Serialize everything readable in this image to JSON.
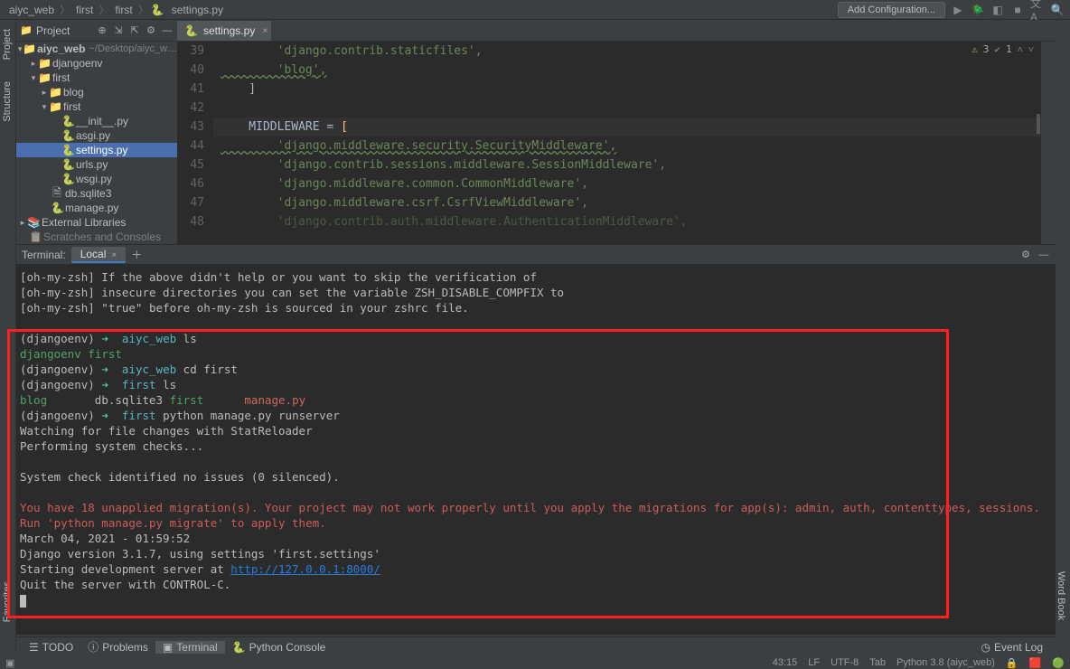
{
  "breadcrumbs": {
    "c1": "aiyc_web",
    "c2": "first",
    "c3": "first",
    "c4": "settings.py"
  },
  "topbar": {
    "config": "Add Configuration..."
  },
  "proj": {
    "title": "Project"
  },
  "tree": {
    "root": "aiyc_web",
    "root_path": "~/Desktop/aiyc_w…",
    "djangoenv": "djangoenv",
    "first1": "first",
    "blog": "blog",
    "first2": "first",
    "init": "__init__.py",
    "asgi": "asgi.py",
    "settings": "settings.py",
    "urls": "urls.py",
    "wsgi": "wsgi.py",
    "db": "db.sqlite3",
    "manage": "manage.py",
    "extlib": "External Libraries",
    "scratch": "Scratches and Consoles"
  },
  "tab": {
    "file": "settings.py"
  },
  "editor_status": {
    "warn": "3",
    "ok": "1"
  },
  "code": {
    "l39n": "39",
    "l39": "        'django.contrib.staticfiles',",
    "l40n": "40",
    "l40": "        'blog',",
    "l41n": "41",
    "l41": "    ]",
    "l42n": "42",
    "l42": "",
    "l43n": "43",
    "l43a": "    MIDDLEWARE = ",
    "l43b": "[",
    "l44n": "44",
    "l44": "        'django.middleware.security.SecurityMiddleware',",
    "l45n": "45",
    "l45": "        'django.contrib.sessions.middleware.SessionMiddleware',",
    "l46n": "46",
    "l46": "        'django.middleware.common.CommonMiddleware',",
    "l47n": "47",
    "l47": "        'django.middleware.csrf.CsrfViewMiddleware',",
    "l48n": "48",
    "l48": "        'django.contrib.auth.middleware.AuthenticationMiddleware',"
  },
  "terminal": {
    "header": "Terminal:",
    "tab": "Local",
    "h1": "[oh-my-zsh] If the above didn't help or you want to skip the verification of",
    "h2": "[oh-my-zsh] insecure directories you can set the variable ZSH_DISABLE_COMPFIX to",
    "h3": "[oh-my-zsh] \"true\" before oh-my-zsh is sourced in your zshrc file.",
    "env": "(djangoenv)",
    "arr": "➜",
    "p1": "aiyc_web",
    "c1": "ls",
    "ls1a": "djangoenv",
    "ls1b": "first",
    "c2": "cd first",
    "p2": "first",
    "c3": "ls",
    "ls2a": "blog",
    "ls2b": "db.sqlite3",
    "ls2c": "first",
    "ls2d": "manage.py",
    "c4": "python manage.py runserver",
    "o1": "Watching for file changes with StatReloader",
    "o2": "Performing system checks...",
    "o3": "System check identified no issues (0 silenced).",
    "w1": "You have 18 unapplied migration(s). Your project may not work properly until you apply the migrations for app(s): admin, auth, contenttypes, sessions.",
    "w2": "Run 'python manage.py migrate' to apply them.",
    "o4": "March 04, 2021 - 01:59:52",
    "o5": "Django version 3.1.7, using settings 'first.settings'",
    "o6a": "Starting development server at ",
    "o6link": "http://127.0.0.1:8000/",
    "o7": "Quit the server with CONTROL-C."
  },
  "bottom": {
    "todo": "TODO",
    "problems": "Problems",
    "terminal": "Terminal",
    "pyconsole": "Python Console",
    "eventlog": "Event Log"
  },
  "status": {
    "pos": "43:15",
    "le": "LF",
    "enc": "UTF-8",
    "tab": "Tab",
    "py": "Python 3.8 (aiyc_web)"
  },
  "strips": {
    "project": "Project",
    "structure": "Structure",
    "favorites": "Favorites",
    "wordbook": "Word Book"
  }
}
